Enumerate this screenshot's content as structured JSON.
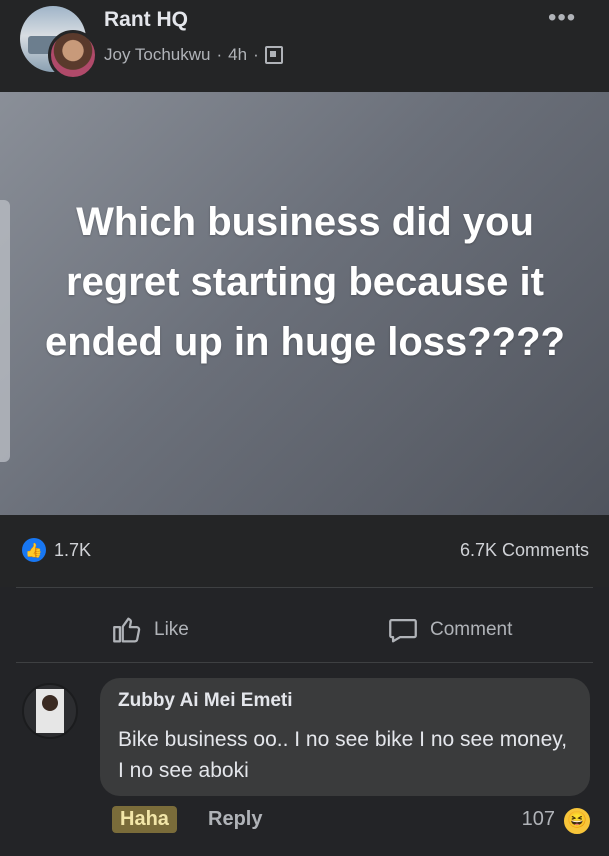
{
  "post": {
    "group_name": "Rant HQ",
    "author": "Joy Tochukwu",
    "time": "4h",
    "separator": "·",
    "more_icon": "•••",
    "privacy_icon": "group-privacy-icon",
    "image_text": "Which business did you regret starting because it ended up in huge loss????"
  },
  "stats": {
    "likes": "1.7K",
    "comments": "6.7K Comments"
  },
  "actions": {
    "like_label": "Like",
    "comment_label": "Comment"
  },
  "comment": {
    "name": "Zubby Ai Mei Emeti",
    "text": "Bike business oo.. I no see bike I no see money, I no see aboki",
    "haha_label": "Haha",
    "reply_label": "Reply",
    "reaction_count": "107"
  },
  "colors": {
    "background": "#232427",
    "accent": "#1877f2",
    "bubble": "#3a3b3c"
  }
}
